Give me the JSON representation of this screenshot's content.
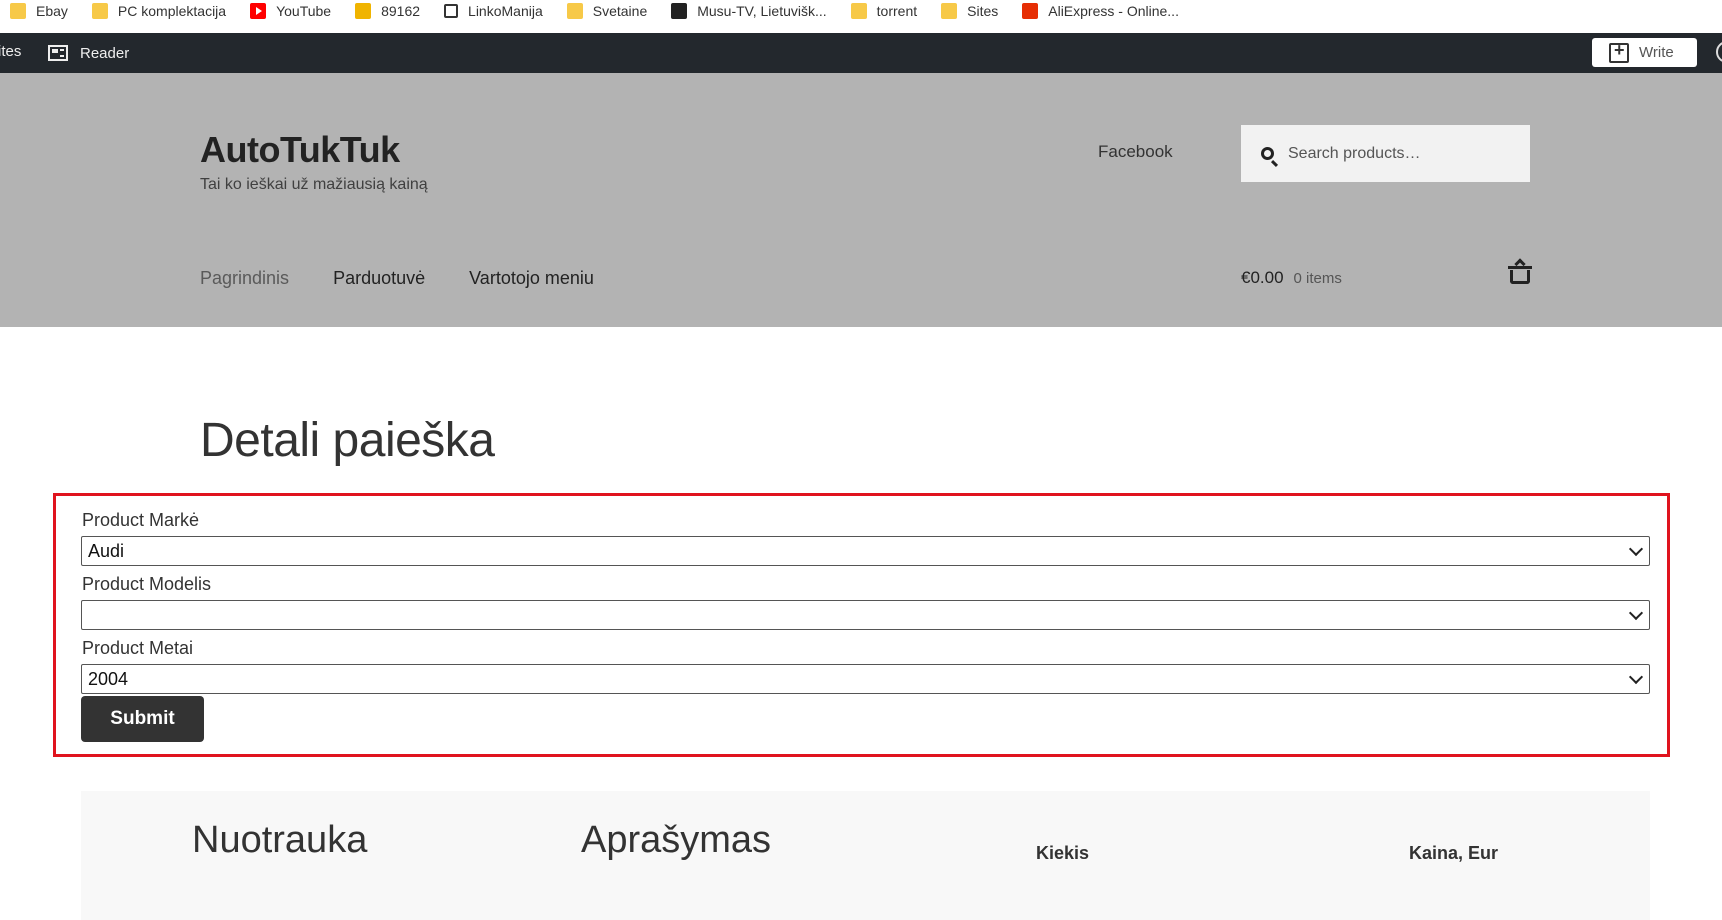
{
  "bookmarks": [
    {
      "label": "Ebay",
      "icon": "folder-icon"
    },
    {
      "label": "PC komplektacija",
      "icon": "folder-icon"
    },
    {
      "label": "YouTube",
      "icon": "youtube-icon"
    },
    {
      "label": "89162",
      "icon": "snail-icon"
    },
    {
      "label": "LinkoManija",
      "icon": "linko-icon"
    },
    {
      "label": "Svetaine",
      "icon": "folder-icon"
    },
    {
      "label": "Musu-TV, Lietuvišk...",
      "icon": "tv-icon"
    },
    {
      "label": "torrent",
      "icon": "folder-icon"
    },
    {
      "label": "Sites",
      "icon": "folder-icon"
    },
    {
      "label": "AliExpress - Online...",
      "icon": "ali-icon"
    }
  ],
  "adminbar": {
    "sites_label": "ites",
    "reader_label": "Reader",
    "write_label": "Write"
  },
  "header": {
    "site_title": "AutoTukTuk",
    "tagline": "Tai ko ieškai už mažiausią kainą",
    "facebook_link": "Facebook",
    "search_placeholder": "Search products…",
    "nav": [
      {
        "label": "Pagrindinis"
      },
      {
        "label": "Parduotuvė"
      },
      {
        "label": "Vartotojo meniu"
      }
    ],
    "cart_amount": "€0.00",
    "cart_count": "0 items"
  },
  "main": {
    "page_title": "Detali paieška",
    "form": {
      "brand_label": "Product Markė",
      "brand_value": "Audi",
      "model_label": "Product Modelis",
      "model_value": "",
      "year_label": "Product Metai",
      "year_value": "2004",
      "submit_label": "Submit"
    },
    "table_headers": {
      "photo": "Nuotrauka",
      "description": "Aprašymas",
      "quantity": "Kiekis",
      "price": "Kaina, Eur"
    }
  },
  "colors": {
    "adminbar_bg": "#23282d",
    "header_bg": "#b3b3b3",
    "highlight_border": "#e0131e",
    "submit_bg": "#333333"
  }
}
